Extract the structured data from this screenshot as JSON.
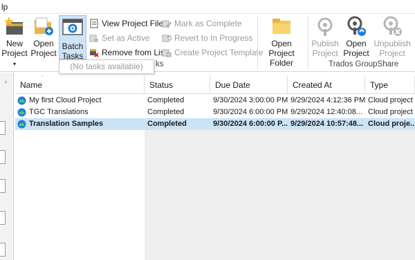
{
  "menu": {
    "fragment": "lp"
  },
  "ribbon": {
    "new_project": "New\nProject",
    "new_project_label_1": "New",
    "new_project_label_2": "Project",
    "open_project_1": "Open",
    "open_project_2": "Project",
    "batch_tasks_1": "Batch",
    "batch_tasks_2": "Tasks",
    "view_project_files": "View Project Files",
    "set_as_active": "Set as Active",
    "remove_from_list": "Remove from List",
    "mark_as_complete": "Mark as Complete",
    "revert_to_in_progress": "Revert to In Progress",
    "create_project_template": "Create Project Template",
    "open_project_folder_1": "Open Project",
    "open_project_folder_2": "Folder",
    "publish_project_1": "Publish",
    "publish_project_2": "Project",
    "gs_open_project_1": "Open",
    "gs_open_project_2": "Project",
    "unpublish_project_1": "Unpublish",
    "unpublish_project_2": "Project",
    "group_tasks_fragment": "ks",
    "group_groupshare": "Trados GroupShare"
  },
  "dropdown": {
    "empty_text": "(No tasks available)"
  },
  "grid": {
    "columns": [
      "Name",
      "Status",
      "Due Date",
      "Created At",
      "Type"
    ],
    "rows": [
      {
        "name": "My first Cloud Project",
        "status": "Completed",
        "due": "9/30/2024 3:00:00 PM",
        "created": "9/29/2024 4:12:36 PM",
        "type": "Cloud project"
      },
      {
        "name": "TGC Translations",
        "status": "Completed",
        "due": "9/30/2024 6:00:00 PM",
        "created": "9/29/2024 12:40:08...",
        "type": "Cloud project"
      },
      {
        "name": "Translation Samples",
        "status": "Completed",
        "due": "9/30/2024 6:00:00 P...",
        "created": "9/29/2024 10:57:48...",
        "type": "Cloud proje..."
      }
    ]
  },
  "colors": {
    "selection": "#cce4f7",
    "accent": "#1e7fd8",
    "folder": "#f3c654"
  }
}
